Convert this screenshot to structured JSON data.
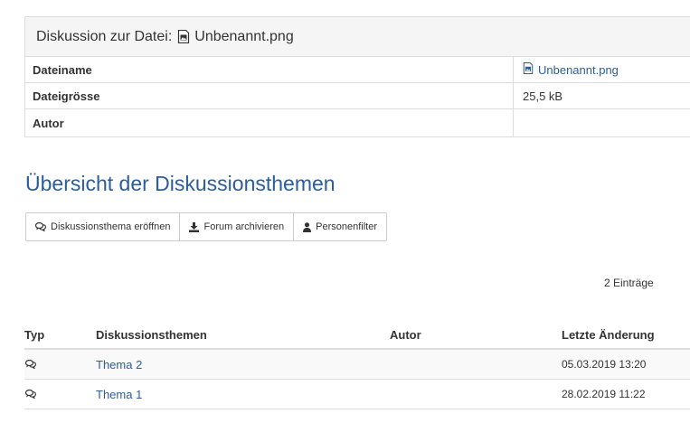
{
  "file_panel": {
    "heading_prefix": "Diskussion zur Datei:",
    "heading_file": "Unbenannt.png",
    "rows": [
      {
        "label": "Dateiname",
        "value": "Unbenannt.png"
      },
      {
        "label": "Dateigrösse",
        "value": "25,5 kB"
      },
      {
        "label": "Autor",
        "value": ""
      }
    ]
  },
  "overview": {
    "title": "Übersicht der Diskussionsthemen",
    "buttons": [
      {
        "label": "Diskussionsthema eröffnen",
        "icon": "comments-icon"
      },
      {
        "label": "Forum archivieren",
        "icon": "download-icon"
      },
      {
        "label": "Personenfilter",
        "icon": "user-icon"
      }
    ],
    "entry_count": "2 Einträge"
  },
  "table": {
    "columns": [
      "Typ",
      "Diskussionsthemen",
      "Autor",
      "Letzte Änderung"
    ],
    "rows": [
      {
        "type_icon": "comments-icon",
        "topic": "Thema 2",
        "author": "",
        "changed": "05.03.2019 13:20"
      },
      {
        "type_icon": "comments-icon",
        "topic": "Thema 1",
        "author": "",
        "changed": "28.02.2019 11:22"
      }
    ]
  },
  "colors": {
    "link": "#2a5d9f",
    "panel_heading_bg": "#f5f5f5",
    "border": "#dddddd"
  }
}
